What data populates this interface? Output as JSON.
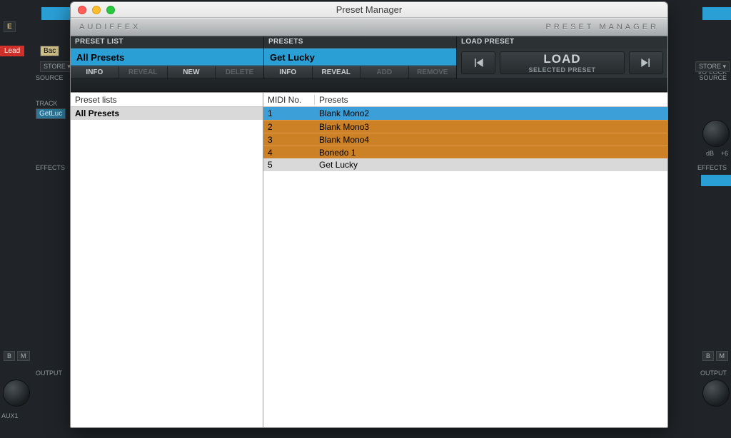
{
  "window": {
    "title": "Preset Manager"
  },
  "brand": {
    "left": "AUDIFFEX",
    "right": "PRESET MANAGER"
  },
  "preset_list": {
    "section_label": "PRESET LIST",
    "active": "All Presets",
    "buttons": {
      "info": "INFO",
      "reveal": "REVEAL",
      "new": "NEW",
      "delete": "DELETE"
    },
    "column_header": "Preset lists",
    "items": [
      {
        "name": "All Presets",
        "selected": true
      }
    ]
  },
  "presets": {
    "section_label": "PRESETS",
    "active": "Get Lucky",
    "buttons": {
      "info": "INFO",
      "reveal": "REVEAL",
      "add": "ADD",
      "remove": "REMOVE"
    },
    "columns": {
      "midi_no": "MIDI No.",
      "presets": "Presets"
    },
    "rows": [
      {
        "num": "1",
        "name": "Blank Mono2",
        "state": "selected-blue"
      },
      {
        "num": "2",
        "name": "Blank Mono3",
        "state": "orange"
      },
      {
        "num": "3",
        "name": "Blank Mono4",
        "state": "orange"
      },
      {
        "num": "4",
        "name": "Bonedo 1",
        "state": "orange"
      },
      {
        "num": "5",
        "name": "Get Lucky",
        "state": "gray"
      }
    ]
  },
  "load_preset": {
    "section_label": "LOAD PRESET",
    "load_label": "LOAD",
    "load_sublabel": "SELECTED PRESET"
  },
  "background": {
    "lead": "Lead",
    "back": "Bac",
    "store": "STORE ▾",
    "source": "SOURCE",
    "track": "TRACK",
    "getluc": "GetLuc",
    "effects": "EFFECTS",
    "b": "B",
    "m": "M",
    "output": "OUTPUT",
    "aux1": "AUX1",
    "e": "E",
    "io": "I/O",
    "lock": "LOCK",
    "db": "dB",
    "plus6": "+6"
  }
}
